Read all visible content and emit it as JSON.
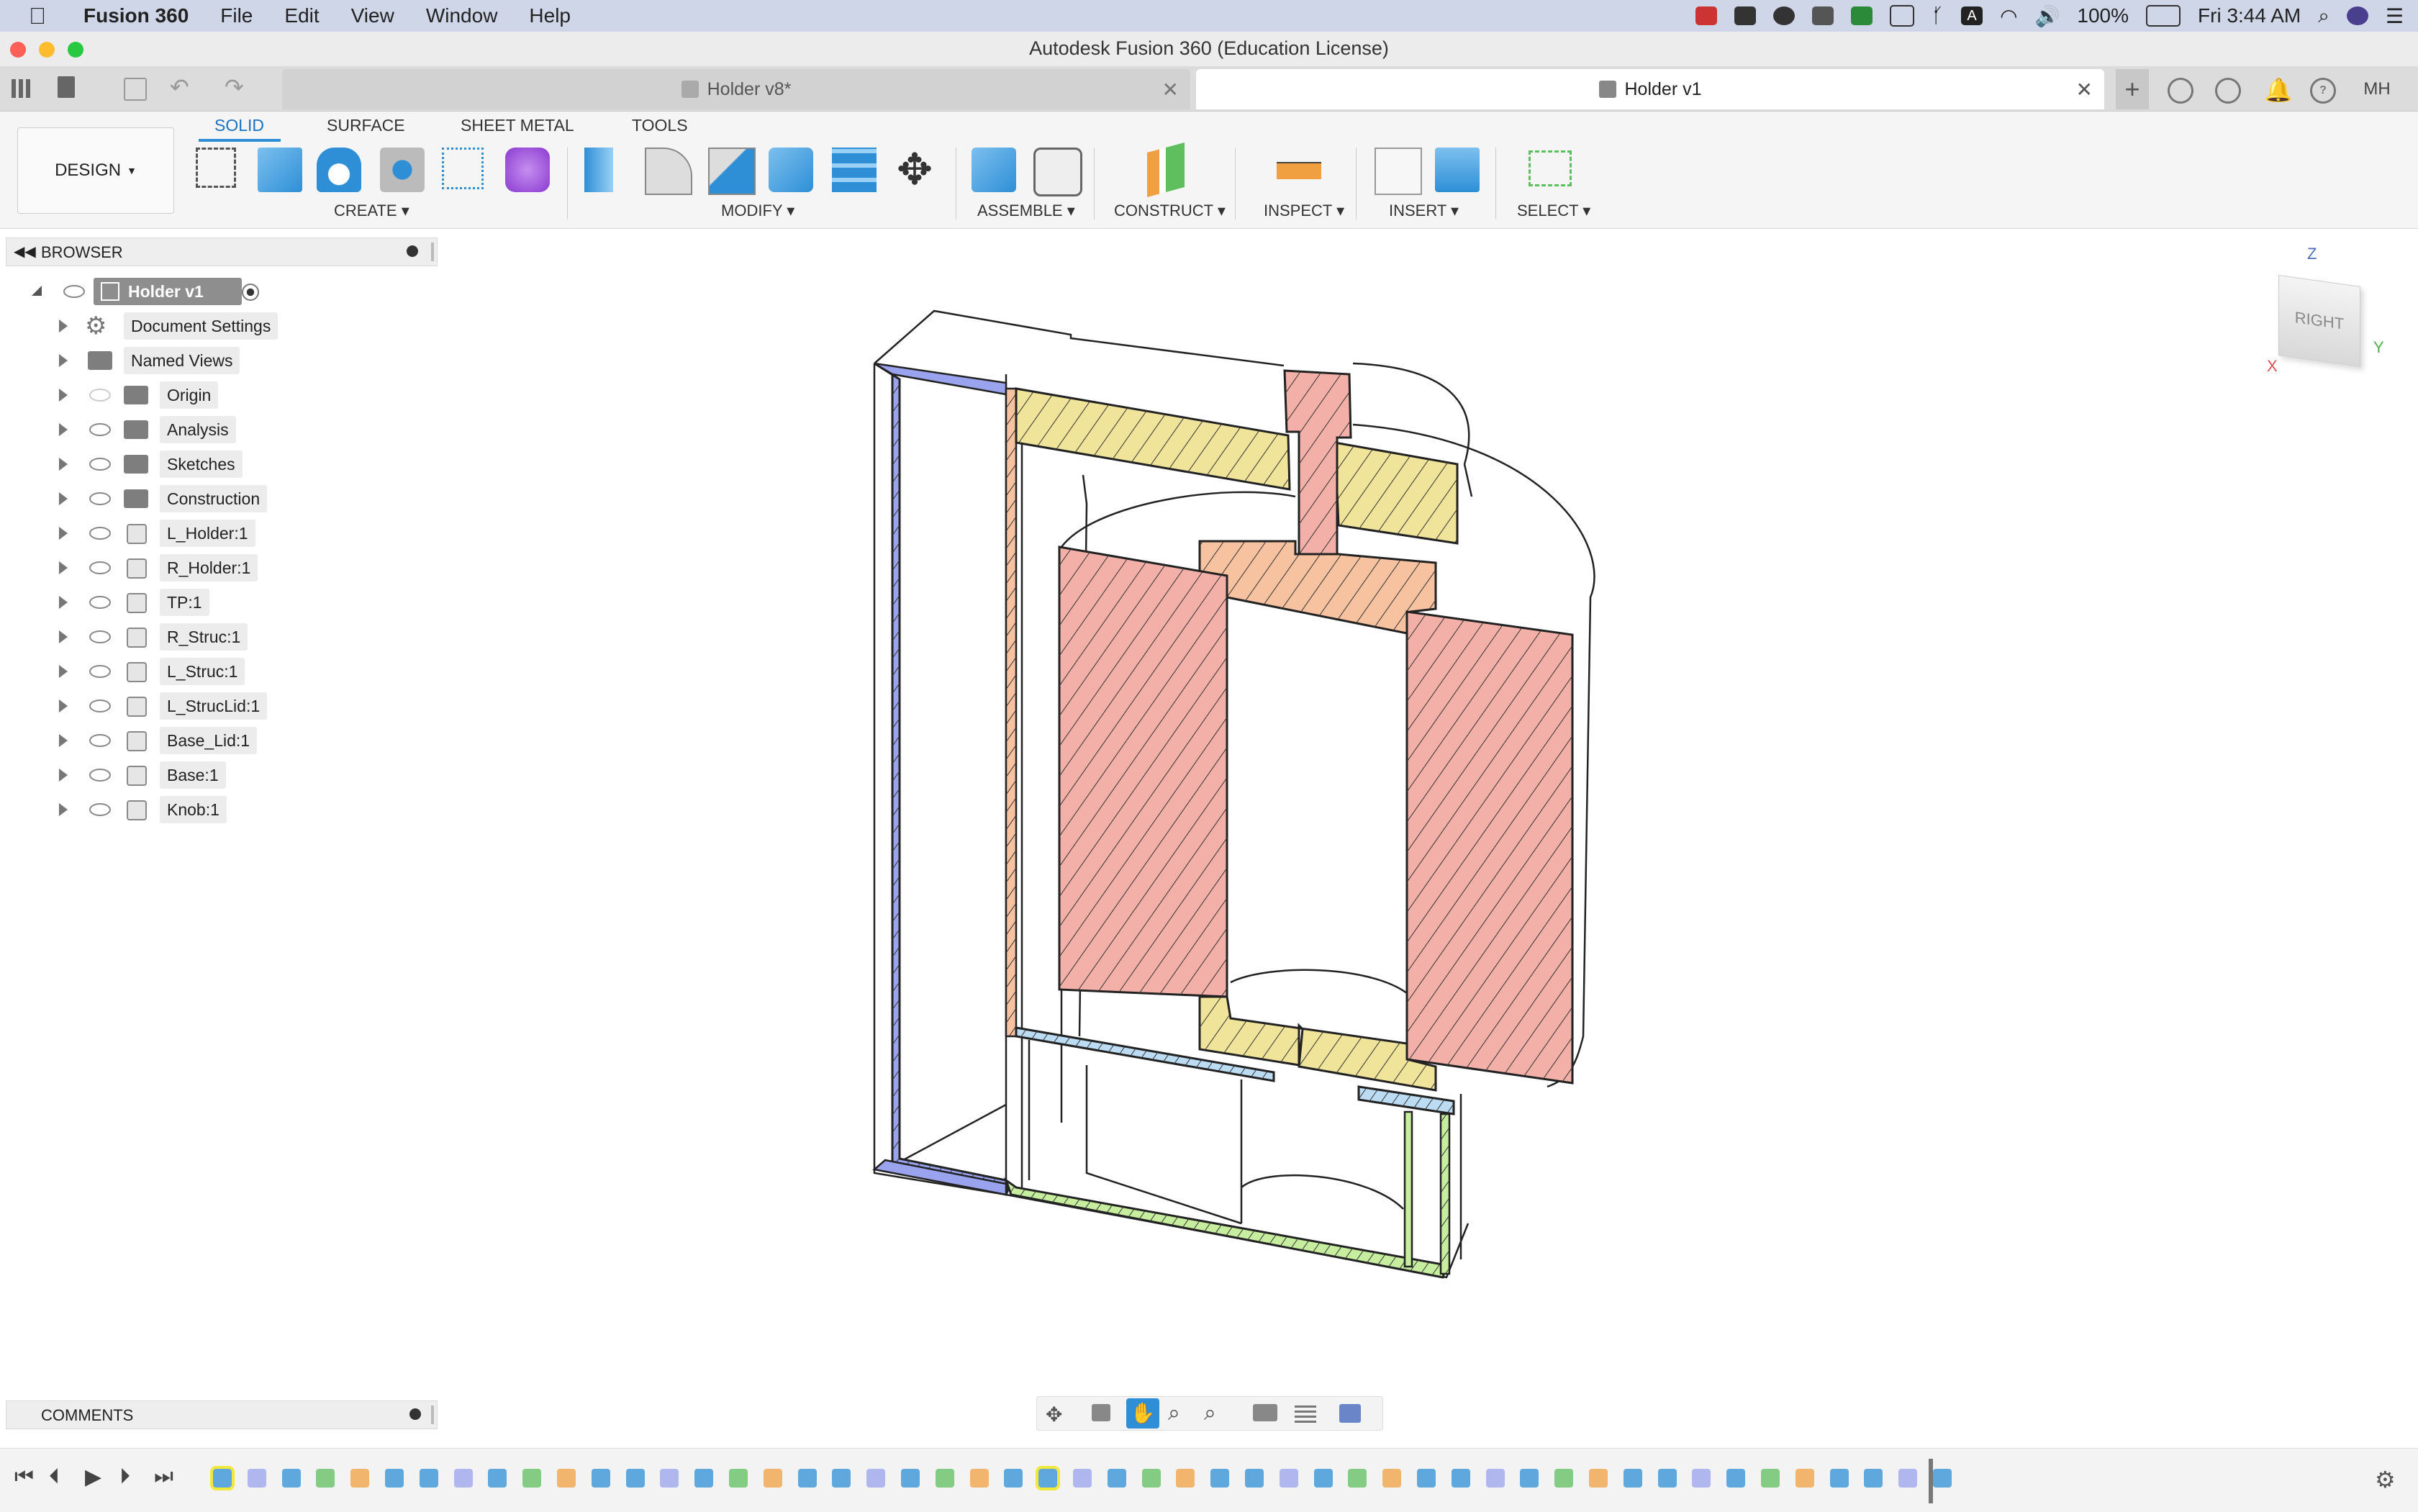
{
  "menubar": {
    "app_name": "Fusion 360",
    "items": [
      "File",
      "Edit",
      "View",
      "Window",
      "Help"
    ],
    "battery": "100%",
    "clock": "Fri 3:44 AM"
  },
  "window": {
    "title": "Autodesk Fusion 360 (Education License)"
  },
  "tabs": [
    {
      "label": "Holder v8*",
      "active": false
    },
    {
      "label": "Holder v1",
      "active": true
    }
  ],
  "user_initials": "MH",
  "toolbar": {
    "workspace": "DESIGN",
    "workspace_tabs": [
      "SOLID",
      "SURFACE",
      "SHEET METAL",
      "TOOLS"
    ],
    "active_tab": "SOLID",
    "groups": {
      "create": "CREATE",
      "modify": "MODIFY",
      "assemble": "ASSEMBLE",
      "construct": "CONSTRUCT",
      "inspect": "INSPECT",
      "insert": "INSERT",
      "select": "SELECT"
    }
  },
  "browser": {
    "title": "BROWSER",
    "root": "Holder v1",
    "items": [
      {
        "label": "Document Settings",
        "icon": "gear-icon"
      },
      {
        "label": "Named Views",
        "icon": "folder-icon"
      },
      {
        "label": "Origin",
        "icon": "folder-icon"
      },
      {
        "label": "Analysis",
        "icon": "folder-icon"
      },
      {
        "label": "Sketches",
        "icon": "folder-icon"
      },
      {
        "label": "Construction",
        "icon": "folder-icon"
      },
      {
        "label": "L_Holder:1",
        "icon": "component-icon"
      },
      {
        "label": "R_Holder:1",
        "icon": "component-icon"
      },
      {
        "label": "TP:1",
        "icon": "component-icon"
      },
      {
        "label": "R_Struc:1",
        "icon": "component-icon"
      },
      {
        "label": "L_Struc:1",
        "icon": "component-icon"
      },
      {
        "label": "L_StrucLid:1",
        "icon": "component-icon"
      },
      {
        "label": "Base_Lid:1",
        "icon": "component-icon"
      },
      {
        "label": "Base:1",
        "icon": "component-icon"
      },
      {
        "label": "Knob:1",
        "icon": "component-icon"
      }
    ]
  },
  "viewcube": {
    "face": "RIGHT",
    "axes": [
      "Z",
      "X",
      "Y"
    ]
  },
  "comments": {
    "title": "COMMENTS"
  },
  "colors": {
    "section_blue": "#9aa3ee",
    "section_yellow": "#f0e39a",
    "section_red": "#f2b0a8",
    "section_orange": "#f7c2a0",
    "section_light_blue": "#bcdcf3",
    "section_green": "#c6ee9e",
    "accent_blue": "#2e8fd6"
  }
}
